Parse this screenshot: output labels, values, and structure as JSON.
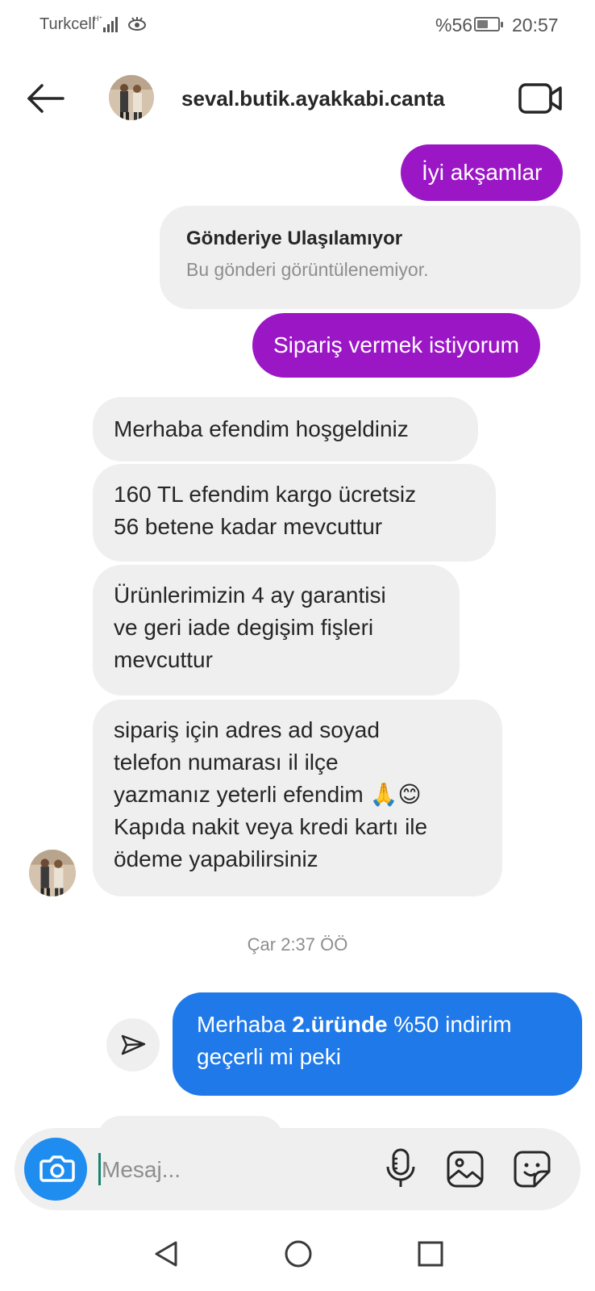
{
  "status_bar": {
    "carrier": "Turkcell",
    "network": "H+",
    "battery_percent": "%56",
    "battery_level": 0.56,
    "time": "20:57"
  },
  "header": {
    "username": "seval.butik.ayakkabi.canta",
    "back_icon": "arrow-left-icon",
    "video_icon": "video-camera-icon"
  },
  "messages": {
    "outgoing_1": "İyi akşamlar",
    "shared_post": {
      "title": "Gönderiye Ulaşılamıyor",
      "subtitle": "Bu gönderi görüntülenemiyor."
    },
    "outgoing_2": "Sipariş vermek istiyorum",
    "incoming_1": "Merhaba efendim hoşgeldiniz",
    "incoming_2": [
      "160 TL efendim kargo ücretsiz",
      "56 betene kadar mevcuttur"
    ],
    "incoming_3": [
      "Ürünlerimizin 4 ay garantisi",
      "ve geri iade degişim fişleri",
      "mevcuttur"
    ],
    "incoming_4": [
      "sipariş için adres ad soyad",
      "telefon numarası il ilçe",
      "yazmanız yeterli efendim 🙏😊",
      "Kapıda nakit veya kredi kartı ile",
      "ödeme yapabilirsiniz"
    ],
    "timestamp": "Çar 2:37 ÖÖ",
    "outgoing_3": {
      "prefix": "Merhaba ",
      "bold": "2.üründe",
      "suffix": " %50 indirim",
      "line2": "geçerli mi peki"
    }
  },
  "composer": {
    "placeholder": "Mesaj...",
    "value": ""
  },
  "colors": {
    "outgoing_purple": "#9b17c5",
    "outgoing_blue": "#1f79e8",
    "incoming_gray": "#efefef",
    "camera_blue": "#1f8cf0"
  }
}
